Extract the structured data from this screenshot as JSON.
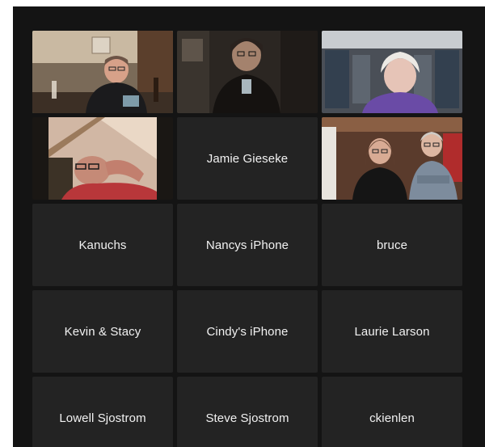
{
  "colors": {
    "background": "#141414",
    "tile_background": "#232323",
    "active_speaker_border": "#3fb950",
    "name_text": "#f1f1f1"
  },
  "participants": [
    {
      "name": "",
      "video": true,
      "active_speaker": true,
      "icon": "avatar-man-glasses-bar"
    },
    {
      "name": "",
      "video": true,
      "active_speaker": false,
      "icon": "avatar-woman-glasses-dark"
    },
    {
      "name": "",
      "video": true,
      "active_speaker": false,
      "icon": "avatar-woman-white-hair-purple"
    },
    {
      "name": "",
      "video": true,
      "active_speaker": false,
      "icon": "avatar-man-reclining-glasses"
    },
    {
      "name": "Jamie Gieseke",
      "video": false,
      "active_speaker": false
    },
    {
      "name": "",
      "video": true,
      "active_speaker": false,
      "icon": "avatar-couple-glasses"
    },
    {
      "name": "Kanuchs",
      "video": false,
      "active_speaker": false
    },
    {
      "name": "Nancys iPhone",
      "video": false,
      "active_speaker": false
    },
    {
      "name": "bruce",
      "video": false,
      "active_speaker": false
    },
    {
      "name": "Kevin & Stacy",
      "video": false,
      "active_speaker": false
    },
    {
      "name": "Cindy's iPhone",
      "video": false,
      "active_speaker": false
    },
    {
      "name": "Laurie Larson",
      "video": false,
      "active_speaker": false
    },
    {
      "name": "Lowell Sjostrom",
      "video": false,
      "active_speaker": false
    },
    {
      "name": "Steve Sjostrom",
      "video": false,
      "active_speaker": false
    },
    {
      "name": "ckienlen",
      "video": false,
      "active_speaker": false
    }
  ]
}
